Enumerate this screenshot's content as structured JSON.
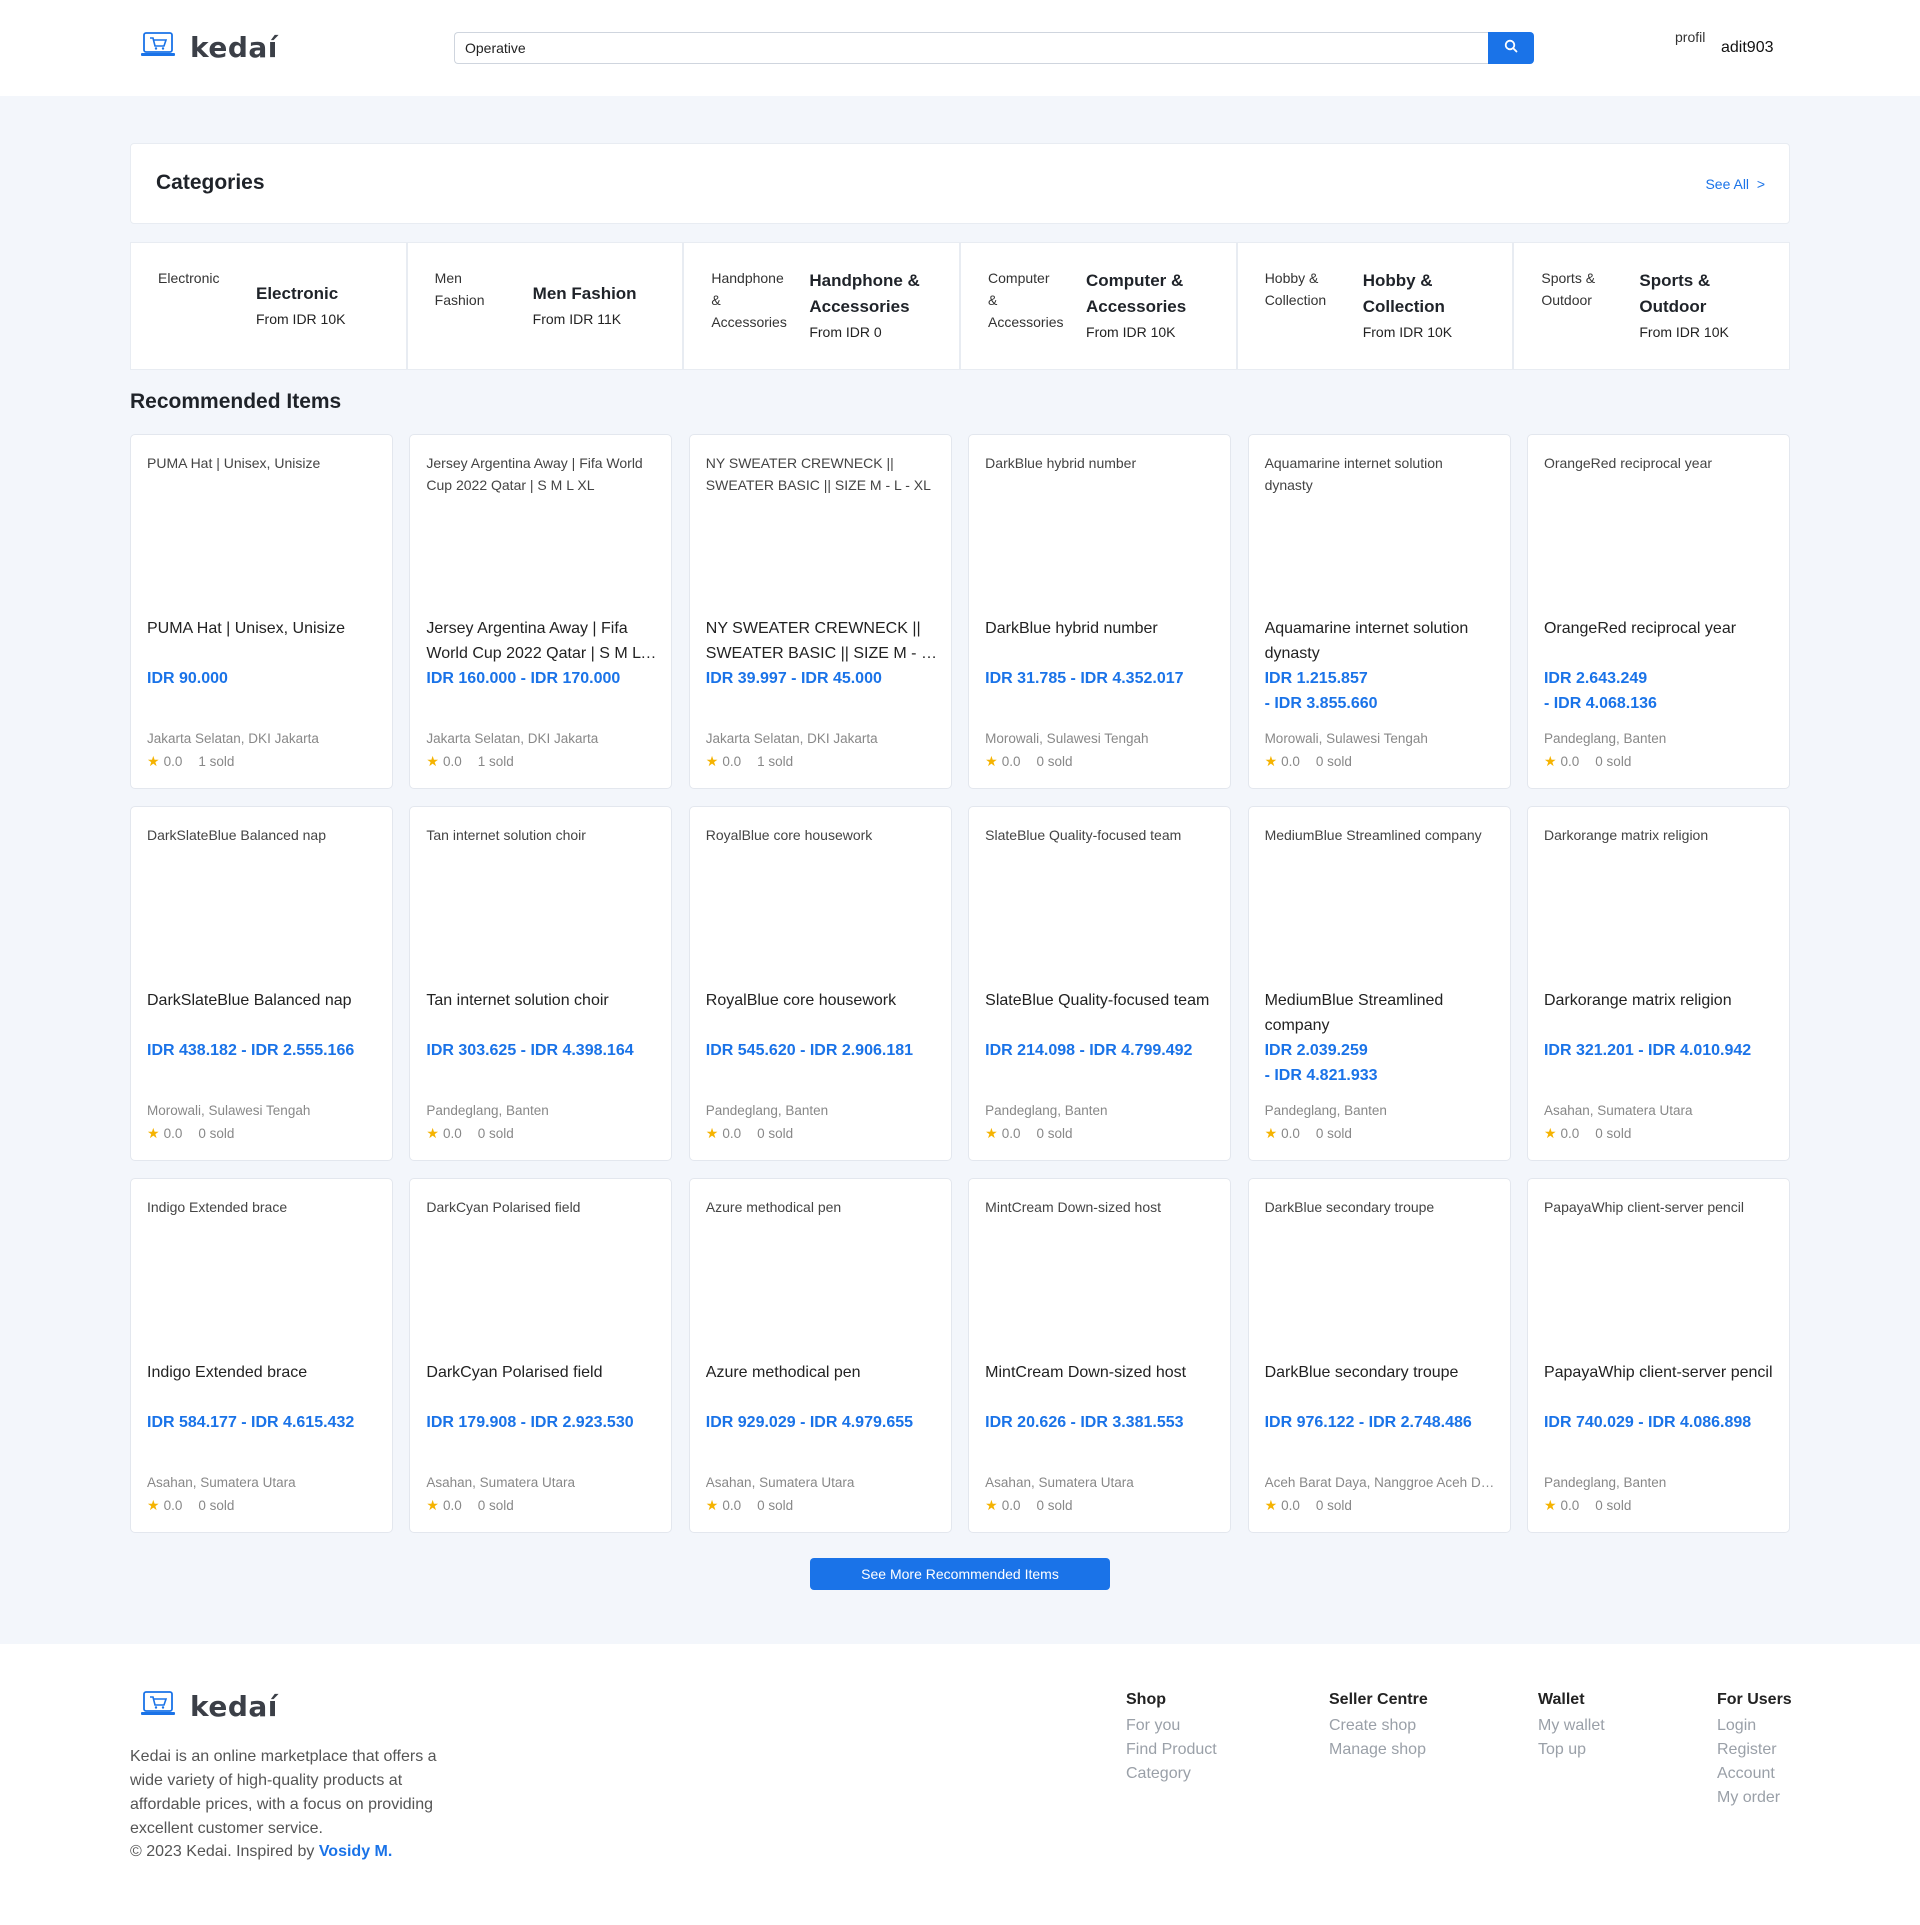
{
  "colors": {
    "accent": "#1a73e8",
    "star": "#f5b301"
  },
  "header": {
    "brand": "kedaí",
    "search_value": "Operative",
    "search_icon": "search-icon",
    "avatar_alt": "profil",
    "username": "adit903"
  },
  "categories": {
    "title": "Categories",
    "see_all": "See All  >",
    "items": [
      {
        "img_alt": "Electronic",
        "name": "Electronic",
        "from": "From IDR 10K"
      },
      {
        "img_alt": "Men Fashion",
        "name": "Men Fashion",
        "from": "From IDR 11K"
      },
      {
        "img_alt": "Handphone & Accessories",
        "name": "Handphone & Accessories",
        "from": "From IDR 0"
      },
      {
        "img_alt": "Computer & Accessories",
        "name": "Computer & Accessories",
        "from": "From IDR 10K"
      },
      {
        "img_alt": "Hobby & Collection",
        "name": "Hobby & Collection",
        "from": "From IDR 10K"
      },
      {
        "img_alt": "Sports & Outdoor",
        "name": "Sports & Outdoor",
        "from": "From IDR 10K"
      }
    ]
  },
  "recommended": {
    "title": "Recommended Items",
    "items": [
      {
        "name": "PUMA Hat | Unisex, Unisize",
        "price": "IDR 90.000",
        "location": "Jakarta Selatan, DKI Jakarta",
        "rating": "0.0",
        "sold": "1 sold"
      },
      {
        "name": "Jersey Argentina Away | Fifa World Cup 2022 Qatar | S M L XL",
        "price": "IDR 160.000 - IDR 170.000",
        "location": "Jakarta Selatan, DKI Jakarta",
        "rating": "0.0",
        "sold": "1 sold"
      },
      {
        "name": "NY SWEATER CREWNECK || SWEATER BASIC || SIZE M - L - XL",
        "price": "IDR 39.997 - IDR 45.000",
        "location": "Jakarta Selatan, DKI Jakarta",
        "rating": "0.0",
        "sold": "1 sold"
      },
      {
        "name": "DarkBlue hybrid number",
        "price": "IDR 31.785 - IDR 4.352.017",
        "location": "Morowali, Sulawesi Tengah",
        "rating": "0.0",
        "sold": "0 sold"
      },
      {
        "name": "Aquamarine internet solution dynasty",
        "price": "IDR 1.215.857\n- IDR 3.855.660",
        "location": "Morowali, Sulawesi Tengah",
        "rating": "0.0",
        "sold": "0 sold"
      },
      {
        "name": "OrangeRed reciprocal year",
        "price": "IDR 2.643.249\n- IDR 4.068.136",
        "location": "Pandeglang, Banten",
        "rating": "0.0",
        "sold": "0 sold"
      },
      {
        "name": "DarkSlateBlue Balanced nap",
        "price": "IDR 438.182 - IDR 2.555.166",
        "location": "Morowali, Sulawesi Tengah",
        "rating": "0.0",
        "sold": "0 sold"
      },
      {
        "name": "Tan internet solution choir",
        "price": "IDR 303.625 - IDR 4.398.164",
        "location": "Pandeglang, Banten",
        "rating": "0.0",
        "sold": "0 sold"
      },
      {
        "name": "RoyalBlue core housework",
        "price": "IDR 545.620 - IDR 2.906.181",
        "location": "Pandeglang, Banten",
        "rating": "0.0",
        "sold": "0 sold"
      },
      {
        "name": "SlateBlue Quality-focused team",
        "price": "IDR 214.098 - IDR 4.799.492",
        "location": "Pandeglang, Banten",
        "rating": "0.0",
        "sold": "0 sold"
      },
      {
        "name": "MediumBlue Streamlined company",
        "price": "IDR 2.039.259\n- IDR 4.821.933",
        "location": "Pandeglang, Banten",
        "rating": "0.0",
        "sold": "0 sold"
      },
      {
        "name": "Darkorange matrix religion",
        "price": "IDR 321.201 - IDR 4.010.942",
        "location": "Asahan, Sumatera Utara",
        "rating": "0.0",
        "sold": "0 sold"
      },
      {
        "name": "Indigo Extended brace",
        "price": "IDR 584.177 - IDR 4.615.432",
        "location": "Asahan, Sumatera Utara",
        "rating": "0.0",
        "sold": "0 sold"
      },
      {
        "name": "DarkCyan Polarised field",
        "price": "IDR 179.908 - IDR 2.923.530",
        "location": "Asahan, Sumatera Utara",
        "rating": "0.0",
        "sold": "0 sold"
      },
      {
        "name": "Azure methodical pen",
        "price": "IDR 929.029 - IDR 4.979.655",
        "location": "Asahan, Sumatera Utara",
        "rating": "0.0",
        "sold": "0 sold"
      },
      {
        "name": "MintCream Down-sized host",
        "price": "IDR 20.626 - IDR 3.381.553",
        "location": "Asahan, Sumatera Utara",
        "rating": "0.0",
        "sold": "0 sold"
      },
      {
        "name": "DarkBlue secondary troupe",
        "price": "IDR 976.122 - IDR 2.748.486",
        "location": "Aceh Barat Daya, Nanggroe Aceh Darussalam",
        "rating": "0.0",
        "sold": "0 sold"
      },
      {
        "name": "PapayaWhip client-server pencil",
        "price": "IDR 740.029 - IDR 4.086.898",
        "location": "Pandeglang, Banten",
        "rating": "0.0",
        "sold": "0 sold"
      }
    ],
    "more_button": "See More Recommended Items"
  },
  "footer": {
    "brand": "kedaí",
    "description": "Kedai is an online marketplace that offers a wide variety of high-quality products at affordable prices, with a focus on providing excellent customer service.",
    "copyright": "© 2023 Kedai. Inspired by",
    "inspired_by": "Vosidy M.",
    "columns": [
      {
        "title": "Shop",
        "links": [
          "For you",
          "Find Product",
          "Category"
        ]
      },
      {
        "title": "Seller Centre",
        "links": [
          "Create shop",
          "Manage shop"
        ]
      },
      {
        "title": "Wallet",
        "links": [
          "My wallet",
          "Top up"
        ]
      },
      {
        "title": "For Users",
        "links": [
          "Login",
          "Register",
          "Account",
          "My order"
        ]
      }
    ]
  }
}
